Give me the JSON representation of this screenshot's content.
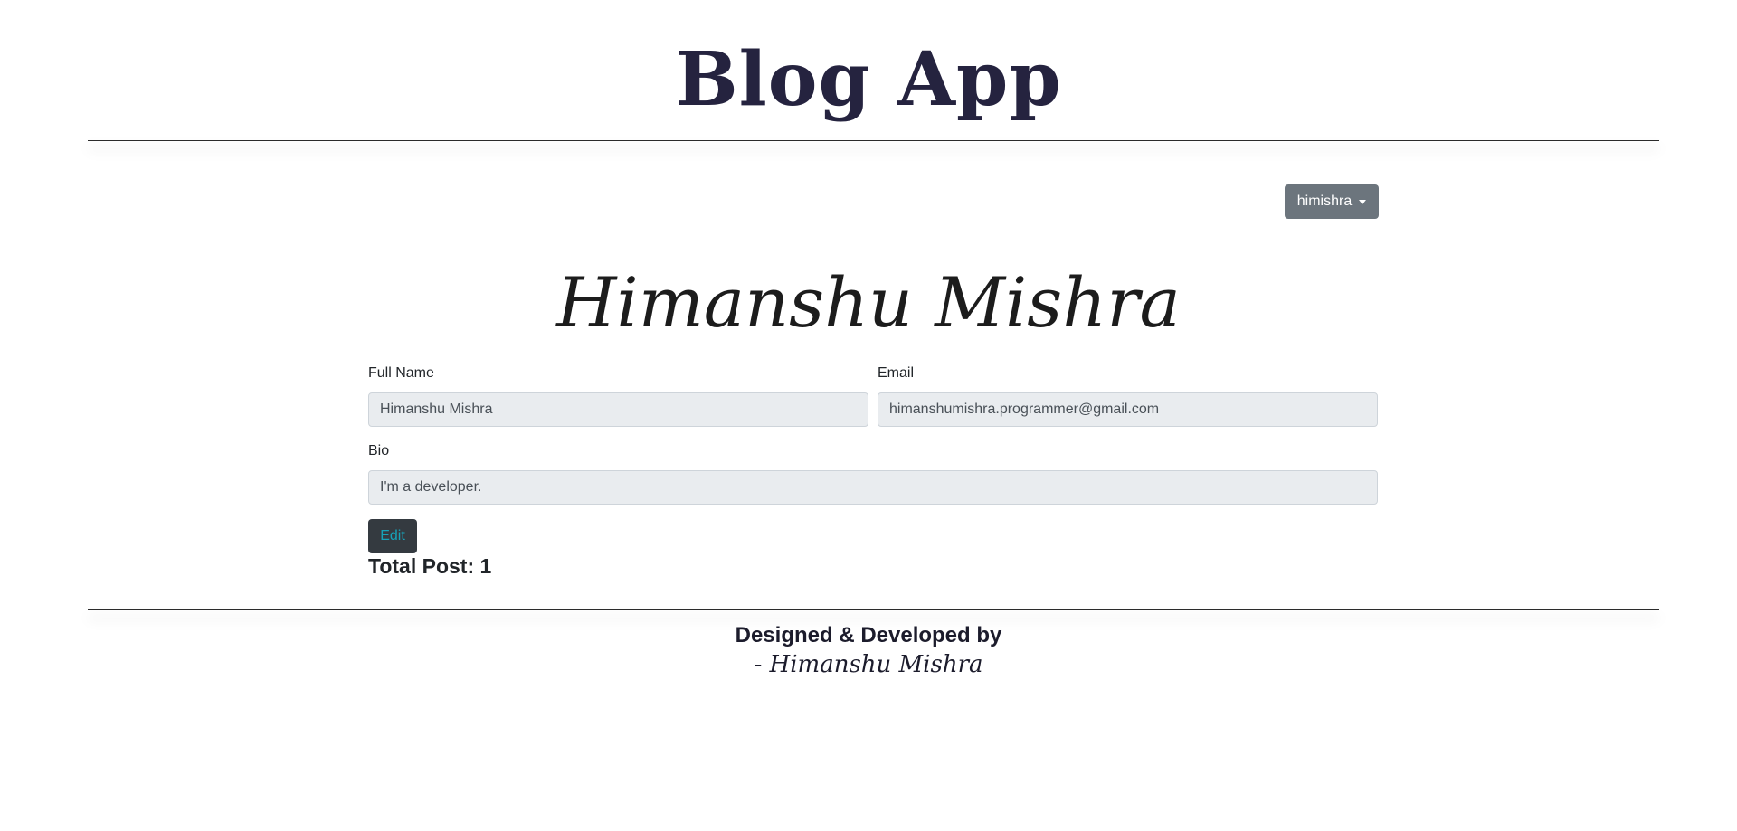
{
  "header": {
    "site_title": "Blog App"
  },
  "user_menu": {
    "username": "himishra"
  },
  "profile": {
    "display_name": "Himanshu Mishra",
    "full_name_label": "Full Name",
    "full_name_value": "Himanshu Mishra",
    "email_label": "Email",
    "email_value": "himanshumishra.programmer@gmail.com",
    "bio_label": "Bio",
    "bio_value": "I'm a developer.",
    "edit_label": "Edit",
    "total_post": "Total Post: 1"
  },
  "footer": {
    "line1": "Designed & Developed by",
    "line2": "- Himanshu Mishra"
  },
  "colors": {
    "title": "#25233f",
    "dropdown_bg": "#6c757d",
    "input_bg": "#e9ecef",
    "edit_bg": "#343a40",
    "edit_text": "#17a2b8"
  },
  "icons": {
    "dropdown_caret": "chevron-down-icon"
  }
}
